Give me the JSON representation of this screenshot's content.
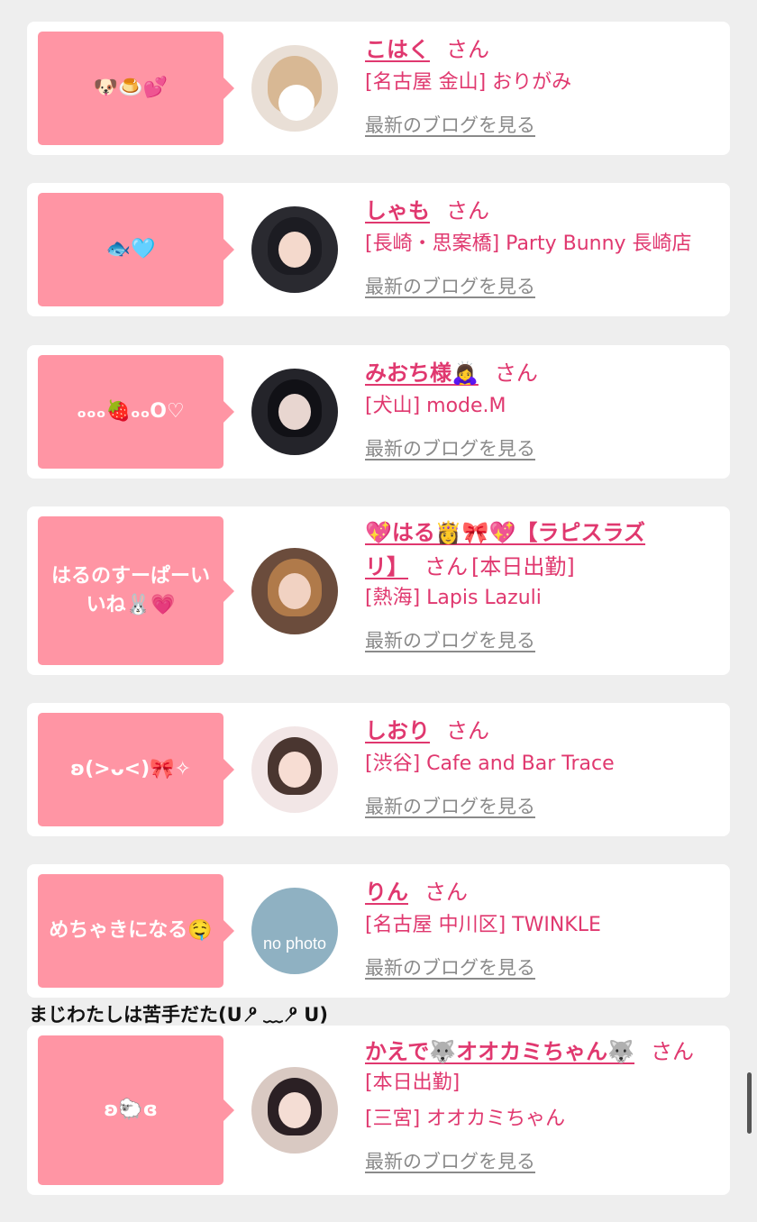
{
  "colors": {
    "background": "#eeeeee",
    "card": "#ffffff",
    "bubble": "#ff95a4",
    "accent": "#e0386f",
    "link_gray": "#8a8a8a"
  },
  "blog_link_label": "最新のブログを見る",
  "san_suffix": "さん",
  "caption": "まじわたしは苦手だた(U ⁰̷ ﹏ ⁰̷ U)",
  "entries": [
    {
      "comment": "🐶🍮💕",
      "name": "こはく",
      "extra": "",
      "shop": "[名古屋 金山] おりがみ",
      "avatar": "blurred-face-photo"
    },
    {
      "comment": "🐟🩵",
      "name": "しゃも",
      "extra": "",
      "shop": "[長崎・思案橋] Party Bunny 長崎店",
      "avatar": "girl-photo-dark"
    },
    {
      "comment": "ₒₒₒ🍓ₒₒO♡",
      "name": "みおち様🙇‍♀️",
      "extra": "",
      "shop": "[犬山] mode.M",
      "avatar": "girl-photo-dark"
    },
    {
      "comment": "はるのすーぱーいいね🐰💗",
      "name_line1": "💖はる👸🎀💖【ラピスラズ",
      "name_line2": "リ】",
      "extra": "[本日出勤]",
      "shop": "[熱海] Lapis Lazuli",
      "avatar": "girl-photo-warm"
    },
    {
      "comment": "ʚ(>ᴗ<)🎀✧",
      "name": "しおり",
      "extra": "",
      "shop": "[渋谷] Cafe and Bar Trace",
      "avatar": "girl-photo-light"
    },
    {
      "comment": "めちゃきになる🤤",
      "name": "りん",
      "extra": "",
      "shop": "[名古屋 中川区] TWINKLE",
      "avatar": "no-photo",
      "avatar_text": "no photo"
    },
    {
      "comment": "ʚ🐑ɞ",
      "name": "かえで🐺オオカミちゃん🐺",
      "extra": "[本日出勤]",
      "shop": "[三宮] オオカミちゃん",
      "avatar": "girl-photo-light"
    }
  ]
}
